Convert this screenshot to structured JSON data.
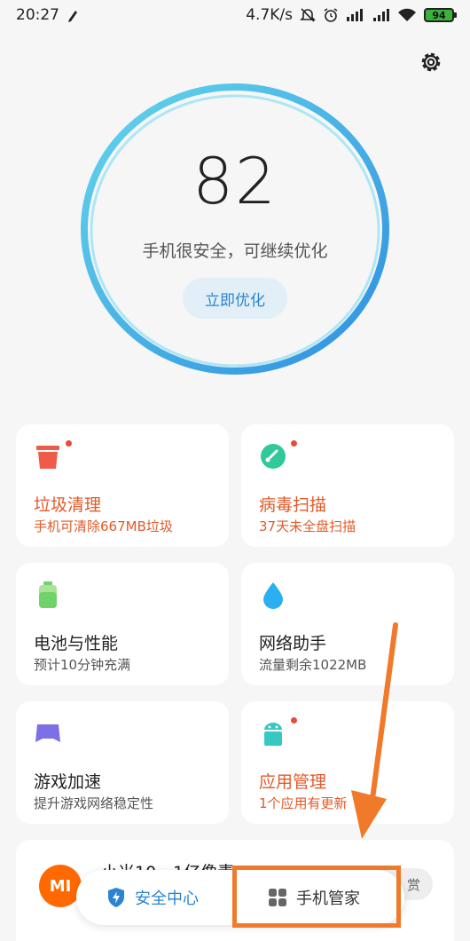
{
  "status_bar": {
    "time": "20:27",
    "network_speed": "4.7K/s",
    "battery_level": "94"
  },
  "header": {
    "settings_icon": "gear-icon"
  },
  "score": {
    "value": "82",
    "status_text": "手机很安全，可继续优化",
    "optimize_label": "立即优化",
    "ring_color": "#35b3e8"
  },
  "cards": [
    {
      "title": "垃圾清理",
      "subtitle": "手机可清除667MB垃圾",
      "icon": "trash-icon",
      "icon_color": "#ef5a4a",
      "alert": true,
      "has_dot": true
    },
    {
      "title": "病毒扫描",
      "subtitle": "37天未全盘扫描",
      "icon": "virus-scan-icon",
      "icon_color": "#2fc99a",
      "alert": true,
      "has_dot": true
    },
    {
      "title": "电池与性能",
      "subtitle": "预计10分钟充满",
      "icon": "battery-icon",
      "icon_color": "#6fd36a",
      "alert": false,
      "has_dot": false
    },
    {
      "title": "网络助手",
      "subtitle": "流量剩余1022MB",
      "icon": "water-drop-icon",
      "icon_color": "#2ab0f0",
      "alert": false,
      "has_dot": false
    },
    {
      "title": "游戏加速",
      "subtitle": "提升游戏网络稳定性",
      "icon": "gamepad-icon",
      "icon_color": "#7d6fe6",
      "alert": false,
      "has_dot": false
    },
    {
      "title": "应用管理",
      "subtitle": "1个应用有更新",
      "icon": "android-icon",
      "icon_color": "#36c9c3",
      "alert": true,
      "has_dot": true
    }
  ],
  "news": {
    "logo_text": "MI",
    "title": "小米10，1亿像素",
    "action_label": "赏"
  },
  "tab_bar": {
    "security_label": "安全中心",
    "manager_label": "手机管家",
    "active_color": "#2a84d2"
  },
  "annotation": {
    "color": "#f07a2a"
  }
}
